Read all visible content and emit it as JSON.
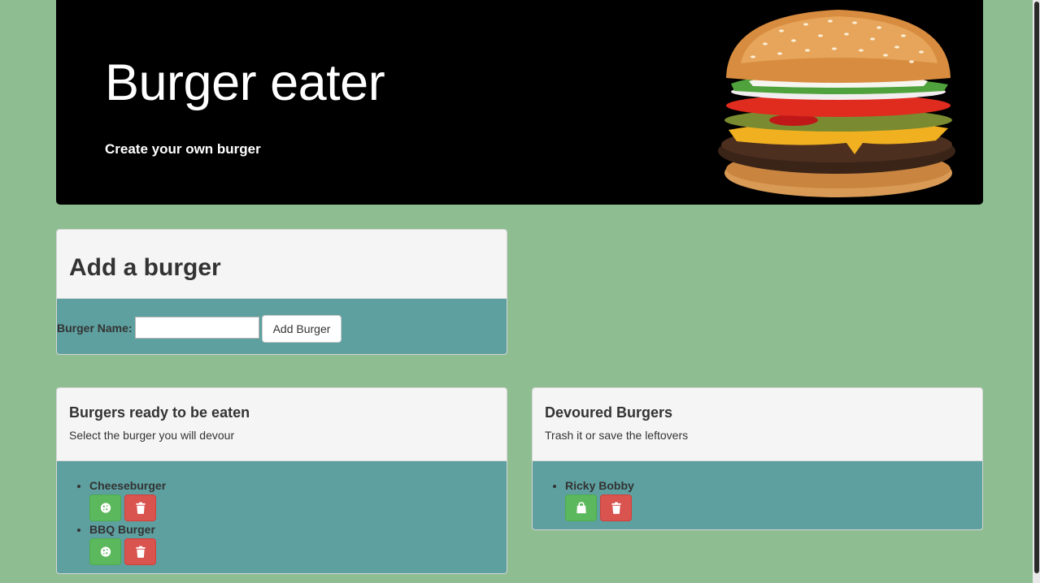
{
  "hero": {
    "title": "Burger eater",
    "subtitle": "Create your own burger"
  },
  "add_form": {
    "heading": "Add a burger",
    "label": "Burger Name:",
    "input_value": "",
    "input_placeholder": "",
    "button_label": "Add Burger"
  },
  "ready": {
    "heading": "Burgers ready to be eaten",
    "subheading": "Select the burger you will devour",
    "items": [
      {
        "name": "Cheeseburger",
        "action_icon": "cookie-icon",
        "delete_icon": "trash-icon"
      },
      {
        "name": "BBQ Burger",
        "action_icon": "cookie-icon",
        "delete_icon": "trash-icon"
      }
    ]
  },
  "devoured": {
    "heading": "Devoured Burgers",
    "subheading": "Trash it or save the leftovers",
    "items": [
      {
        "name": "Ricky Bobby",
        "action_icon": "shopping-bag-icon",
        "delete_icon": "trash-icon"
      }
    ]
  },
  "colors": {
    "page_background": "#8dbd91",
    "panel_body": "#5e9f9f",
    "success": "#5cb85c",
    "danger": "#d9534f"
  }
}
